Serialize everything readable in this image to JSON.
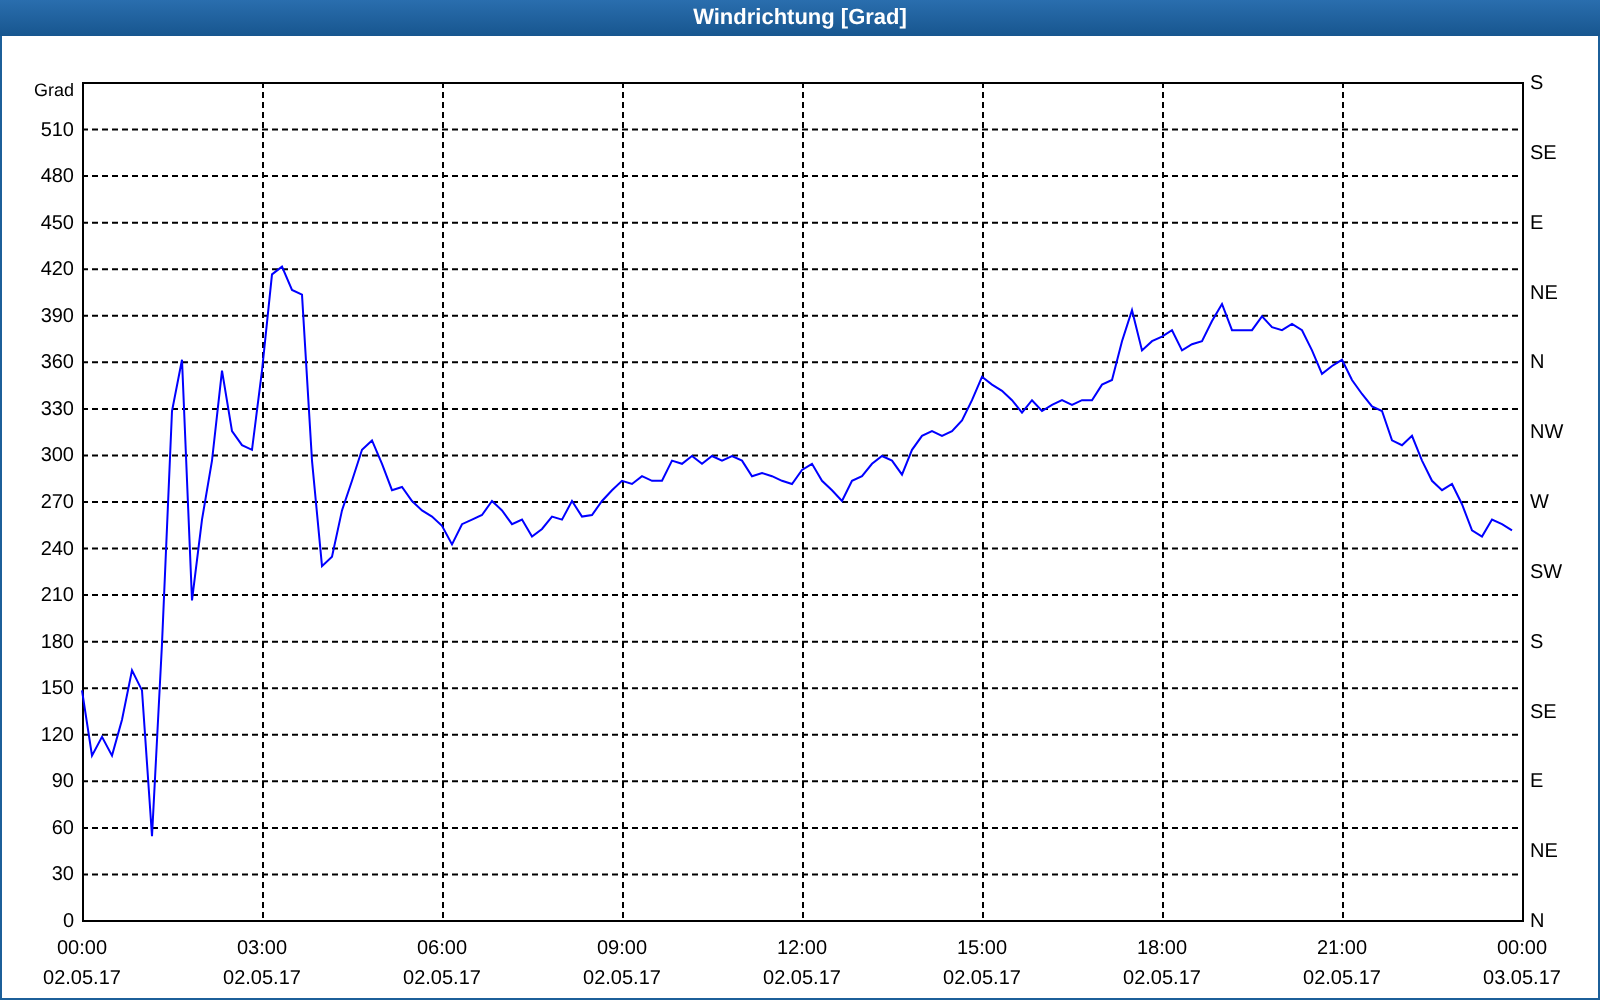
{
  "window": {
    "title": "Windrichtung [Grad]"
  },
  "chart": {
    "right_axis_labels": [
      "S",
      "SE",
      "E",
      "NE",
      "N",
      "NW",
      "W",
      "SW",
      "S",
      "SE",
      "E",
      "NE",
      "N"
    ],
    "chart_data": {
      "type": "line",
      "ylabel": "Grad",
      "ylim": [
        0,
        540
      ],
      "grid": true,
      "yticks": [
        {
          "value": 0,
          "label": "0"
        },
        {
          "value": 30,
          "label": "30"
        },
        {
          "value": 60,
          "label": "60"
        },
        {
          "value": 90,
          "label": "90"
        },
        {
          "value": 120,
          "label": "120"
        },
        {
          "value": 150,
          "label": "150"
        },
        {
          "value": 180,
          "label": "180"
        },
        {
          "value": 210,
          "label": "210"
        },
        {
          "value": 240,
          "label": "240"
        },
        {
          "value": 270,
          "label": "270"
        },
        {
          "value": 300,
          "label": "300"
        },
        {
          "value": 330,
          "label": "330"
        },
        {
          "value": 360,
          "label": "360"
        },
        {
          "value": 390,
          "label": "390"
        },
        {
          "value": 420,
          "label": "420"
        },
        {
          "value": 450,
          "label": "450"
        },
        {
          "value": 480,
          "label": "480"
        },
        {
          "value": 510,
          "label": "510"
        }
      ],
      "categories": [
        "00:00 02.05.17",
        null,
        null,
        null,
        null,
        null,
        null,
        null,
        null,
        null,
        null,
        null,
        null,
        null,
        null,
        null,
        null,
        null,
        "03:00 02.05.17",
        null,
        null,
        null,
        null,
        null,
        null,
        null,
        null,
        null,
        null,
        null,
        null,
        null,
        null,
        null,
        null,
        null,
        "06:00 02.05.17",
        null,
        null,
        null,
        null,
        null,
        null,
        null,
        null,
        null,
        null,
        null,
        null,
        null,
        null,
        null,
        null,
        null,
        "09:00 02.05.17",
        null,
        null,
        null,
        null,
        null,
        null,
        null,
        null,
        null,
        null,
        null,
        null,
        null,
        null,
        null,
        null,
        null,
        "12:00 02.05.17",
        null,
        null,
        null,
        null,
        null,
        null,
        null,
        null,
        null,
        null,
        null,
        null,
        null,
        null,
        null,
        null,
        null,
        "15:00 02.05.17",
        null,
        null,
        null,
        null,
        null,
        null,
        null,
        null,
        null,
        null,
        null,
        null,
        null,
        null,
        null,
        null,
        null,
        "18:00 02.05.17",
        null,
        null,
        null,
        null,
        null,
        null,
        null,
        null,
        null,
        null,
        null,
        null,
        null,
        null,
        null,
        null,
        null,
        "21:00 02.05.17",
        null,
        null,
        null,
        null,
        null,
        null,
        null,
        null,
        null,
        null,
        null,
        null,
        null,
        null,
        null,
        null,
        null,
        "00:00 03.05.17"
      ],
      "series": [
        {
          "color": "#0000ff",
          "values": [
            148,
            106,
            118,
            106,
            129,
            161,
            148,
            54,
            178,
            328,
            361,
            206,
            258,
            296,
            354,
            315,
            306,
            303,
            354,
            416,
            421,
            406,
            403,
            296,
            228,
            234,
            264,
            283,
            303,
            309,
            294,
            277,
            279,
            270,
            264,
            260,
            254,
            242,
            255,
            258,
            261,
            270,
            264,
            255,
            258,
            247,
            252,
            260,
            258,
            270,
            260,
            261,
            270,
            277,
            283,
            281,
            286,
            283,
            283,
            296,
            294,
            299,
            294,
            299,
            296,
            299,
            296,
            286,
            288,
            286,
            283,
            281,
            290,
            294,
            283,
            277,
            270,
            283,
            286,
            294,
            299,
            296,
            287,
            303,
            312,
            315,
            312,
            315,
            322,
            335,
            350,
            345,
            341,
            335,
            327,
            335,
            328,
            332,
            335,
            332,
            335,
            335,
            345,
            348,
            373,
            393,
            367,
            373,
            376,
            380,
            367,
            371,
            373,
            386,
            397,
            380,
            380,
            380,
            389,
            382,
            380,
            384,
            380,
            367,
            352,
            357,
            361,
            348,
            339,
            331,
            328,
            309,
            306,
            312,
            296,
            283,
            277,
            281,
            268,
            251,
            247,
            258,
            255,
            251,
            null
          ]
        }
      ]
    }
  }
}
